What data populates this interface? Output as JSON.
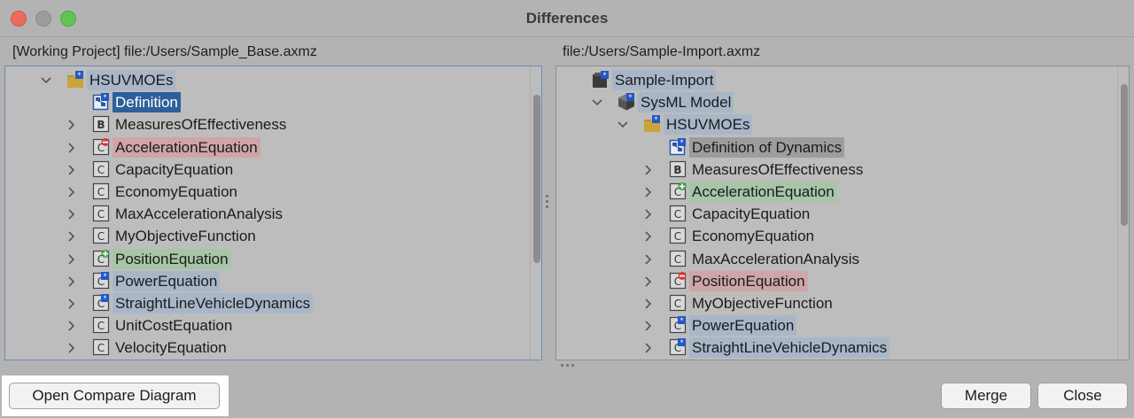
{
  "window": {
    "title": "Differences"
  },
  "left_pane": {
    "label": "[Working Project] file:/Users/Sample_Base.axmz",
    "rows": [
      {
        "text": "HSUVMOEs",
        "level": 1,
        "chevron": "down",
        "icon": "package-icon",
        "badge": "star",
        "hl": "blue"
      },
      {
        "text": "Definition",
        "level": 2,
        "chevron": "",
        "icon": "diagram-icon",
        "badge": "star",
        "hl": "sel"
      },
      {
        "text": "MeasuresOfEffectiveness",
        "level": 2,
        "chevron": "right",
        "icon": "block-icon",
        "badge": "",
        "hl": ""
      },
      {
        "text": "AccelerationEquation",
        "level": 2,
        "chevron": "right",
        "icon": "constraint-icon",
        "badge": "minus",
        "hl": "red"
      },
      {
        "text": "CapacityEquation",
        "level": 2,
        "chevron": "right",
        "icon": "constraint-icon",
        "badge": "",
        "hl": ""
      },
      {
        "text": "EconomyEquation",
        "level": 2,
        "chevron": "right",
        "icon": "constraint-icon",
        "badge": "",
        "hl": ""
      },
      {
        "text": "MaxAccelerationAnalysis",
        "level": 2,
        "chevron": "right",
        "icon": "constraint-icon",
        "badge": "",
        "hl": ""
      },
      {
        "text": "MyObjectiveFunction",
        "level": 2,
        "chevron": "right",
        "icon": "constraint-icon",
        "badge": "",
        "hl": ""
      },
      {
        "text": "PositionEquation",
        "level": 2,
        "chevron": "right",
        "icon": "constraint-icon",
        "badge": "plus",
        "hl": "green"
      },
      {
        "text": "PowerEquation",
        "level": 2,
        "chevron": "right",
        "icon": "constraint-icon",
        "badge": "star",
        "hl": "blue"
      },
      {
        "text": "StraightLineVehicleDynamics",
        "level": 2,
        "chevron": "right",
        "icon": "constraint-icon",
        "badge": "star",
        "hl": "blue"
      },
      {
        "text": "UnitCostEquation",
        "level": 2,
        "chevron": "right",
        "icon": "constraint-icon",
        "badge": "",
        "hl": ""
      },
      {
        "text": "VelocityEquation",
        "level": 2,
        "chevron": "right",
        "icon": "constraint-icon",
        "badge": "",
        "hl": ""
      }
    ]
  },
  "right_pane": {
    "label": "file:/Users/Sample-Import.axmz",
    "rows": [
      {
        "text": "Sample-Import",
        "level": 0,
        "chevron": "",
        "icon": "project-icon",
        "badge": "star",
        "hl": "blue"
      },
      {
        "text": "SysML Model",
        "level": 1,
        "chevron": "down",
        "icon": "model-icon",
        "badge": "star",
        "hl": "blue"
      },
      {
        "text": "HSUVMOEs",
        "level": 2,
        "chevron": "down",
        "icon": "package-icon",
        "badge": "star",
        "hl": "blue"
      },
      {
        "text": "Definition of Dynamics",
        "level": 3,
        "chevron": "",
        "icon": "diagram-icon",
        "badge": "star",
        "hl": "gray"
      },
      {
        "text": "MeasuresOfEffectiveness",
        "level": 3,
        "chevron": "right",
        "icon": "block-icon",
        "badge": "",
        "hl": ""
      },
      {
        "text": "AccelerationEquation",
        "level": 3,
        "chevron": "right",
        "icon": "constraint-icon",
        "badge": "plus",
        "hl": "green"
      },
      {
        "text": "CapacityEquation",
        "level": 3,
        "chevron": "right",
        "icon": "constraint-icon",
        "badge": "",
        "hl": ""
      },
      {
        "text": "EconomyEquation",
        "level": 3,
        "chevron": "right",
        "icon": "constraint-icon",
        "badge": "",
        "hl": ""
      },
      {
        "text": "MaxAccelerationAnalysis",
        "level": 3,
        "chevron": "right",
        "icon": "constraint-icon",
        "badge": "",
        "hl": ""
      },
      {
        "text": "PositionEquation",
        "level": 3,
        "chevron": "right",
        "icon": "constraint-icon",
        "badge": "minus",
        "hl": "red"
      },
      {
        "text": "MyObjectiveFunction",
        "level": 3,
        "chevron": "right",
        "icon": "constraint-icon",
        "badge": "",
        "hl": ""
      },
      {
        "text": "PowerEquation",
        "level": 3,
        "chevron": "right",
        "icon": "constraint-icon",
        "badge": "star",
        "hl": "blue"
      },
      {
        "text": "StraightLineVehicleDynamics",
        "level": 3,
        "chevron": "right",
        "icon": "constraint-icon",
        "badge": "star",
        "hl": "blue"
      }
    ]
  },
  "buttons": {
    "open_compare": "Open Compare Diagram",
    "merge": "Merge",
    "close": "Close"
  },
  "colors": {
    "selection": "#2d5f9a",
    "changed": "#a8b6c8",
    "removed": "#cfa5a8",
    "added": "#a6c6a7",
    "badge_star": "#2457c5",
    "badge_minus": "#d9393b",
    "badge_plus": "#3aa043"
  }
}
